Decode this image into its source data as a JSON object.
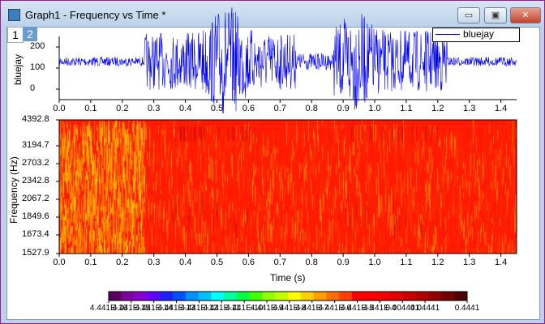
{
  "window": {
    "title": "Graph1 - Frequency vs Time *",
    "minimize": "▭",
    "maximize": "▣",
    "close": "✕"
  },
  "layers": [
    "1",
    "2"
  ],
  "top_plot": {
    "ylabel": "bluejay",
    "legend": "bluejay",
    "yticks": [
      "0",
      "100",
      "200"
    ],
    "xticks": [
      "0.0",
      "0.1",
      "0.2",
      "0.3",
      "0.4",
      "0.5",
      "0.6",
      "0.7",
      "0.8",
      "0.9",
      "1.0",
      "1.1",
      "1.2",
      "1.3",
      "1.4"
    ],
    "line_color": "#0000ff"
  },
  "spectrogram": {
    "ylabel": "Frequency (Hz)",
    "xlabel": "Time (s)",
    "yticks": [
      "1527.9",
      "1673.4",
      "1849.6",
      "2067.2",
      "2342.8",
      "2703.2",
      "3194.7",
      "4392.8"
    ],
    "xticks": [
      "0.0",
      "0.1",
      "0.2",
      "0.3",
      "0.4",
      "0.5",
      "0.6",
      "0.7",
      "0.8",
      "0.9",
      "1.0",
      "1.1",
      "1.2",
      "1.3",
      "1.4"
    ]
  },
  "colorbar": {
    "labels": [
      "4.441E-16",
      "4.441E-15",
      "4.441E-14",
      "4.441E-13",
      "4.441E-12",
      "4.441E-11",
      "4.441E-10",
      "4.441E-9",
      "4.441E-8",
      "4.441E-7",
      "4.441E-6",
      "4.441E-5",
      "4.441E-4",
      "0.004441",
      "0.04441",
      "0.4441"
    ]
  }
}
